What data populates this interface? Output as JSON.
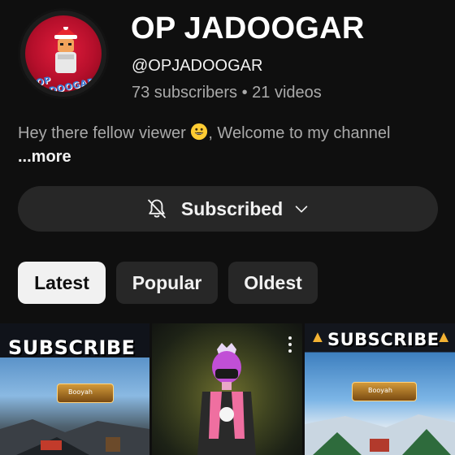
{
  "channel": {
    "title": "OP JADOOGAR",
    "handle": "@OPJADOOGAR",
    "stats": "73 subscribers • 21 videos",
    "avatar_text": "OP JADOOGAR"
  },
  "description": {
    "line_part1": "Hey there fellow viewer",
    "line_part2": ", Welcome to my channel",
    "more_label": "...more",
    "emoji": "grinning-face-icon"
  },
  "subscribe": {
    "label": "Subscribed",
    "bell_icon": "bell-off-icon",
    "chevron_icon": "chevron-down-icon"
  },
  "tabs": {
    "items": [
      {
        "label": "Latest",
        "active": true
      },
      {
        "label": "Popular",
        "active": false
      },
      {
        "label": "Oldest",
        "active": false
      }
    ]
  },
  "videos": [
    {
      "overlay_text": "SUBSCRIBE",
      "hud_text": "Booyah"
    },
    {
      "overlay_text": "",
      "menu_icon": "more-vert-icon"
    },
    {
      "overlay_text": "SUBSCRIBE",
      "hud_text": "Booyah"
    }
  ],
  "colors": {
    "background": "#0f0f0f",
    "surface": "#272727",
    "text_primary": "#f1f1f1",
    "text_secondary": "#aaaaaa",
    "chip_active_bg": "#f1f1f1"
  }
}
